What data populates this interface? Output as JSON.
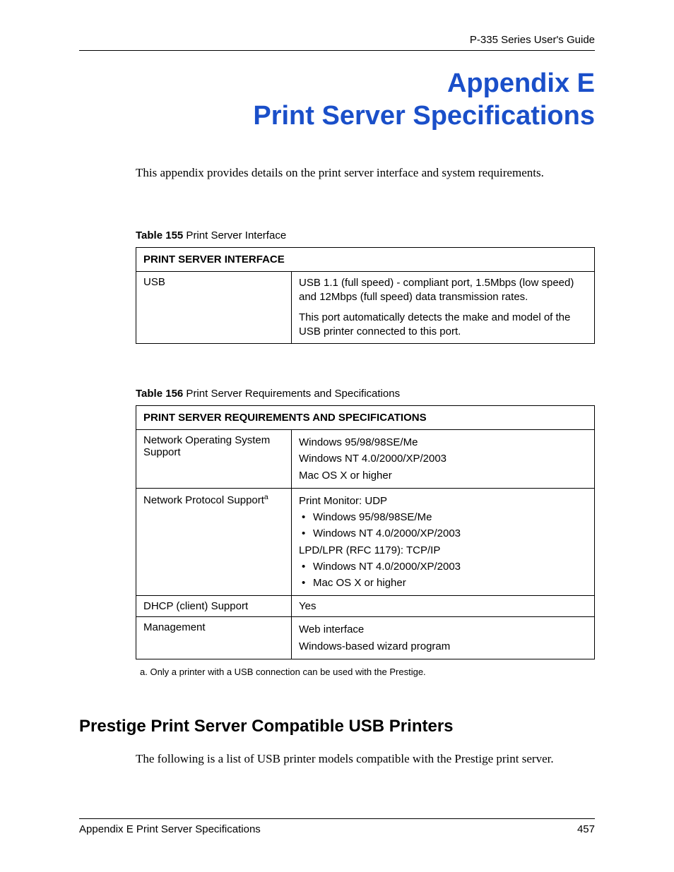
{
  "header": {
    "guide": "P-335 Series User's Guide"
  },
  "title": {
    "line1": "Appendix E",
    "line2": "Print Server Specifications"
  },
  "intro": "This appendix provides details on the print server interface and system requirements.",
  "table155": {
    "caption_bold": "Table 155",
    "caption_rest": "   Print Server Interface",
    "header": "PRINT SERVER INTERFACE",
    "row_label": "USB",
    "row_p1": "USB 1.1 (full speed) - compliant port, 1.5Mbps (low speed) and 12Mbps (full speed) data transmission rates.",
    "row_p2": "This port automatically detects the make and model of the USB printer connected to this port."
  },
  "table156": {
    "caption_bold": "Table 156",
    "caption_rest": "   Print Server Requirements and Specifications",
    "header": "PRINT SERVER REQUIREMENTS AND SPECIFICATIONS",
    "r1_label": "Network Operating System Support",
    "r1_v1": "Windows 95/98/98SE/Me",
    "r1_v2": "Windows NT 4.0/2000/XP/2003",
    "r1_v3": "Mac OS X or higher",
    "r2_label_base": "Network Protocol Support",
    "r2_sup": "a",
    "r2_intro1": "Print Monitor: UDP",
    "r2_b1": "Windows 95/98/98SE/Me",
    "r2_b2": "Windows NT 4.0/2000/XP/2003",
    "r2_intro2": "LPD/LPR (RFC 1179): TCP/IP",
    "r2_b3": "Windows NT 4.0/2000/XP/2003",
    "r2_b4": "Mac OS X or higher",
    "r3_label": "DHCP (client) Support",
    "r3_val": "Yes",
    "r4_label": "Management",
    "r4_v1": "Web interface",
    "r4_v2": "Windows-based wizard program"
  },
  "footnote": "a.  Only a printer with a USB connection can be used with the Prestige.",
  "section": {
    "heading": "Prestige Print Server Compatible USB Printers",
    "body": "The following is a list of USB printer models compatible with the Prestige print server."
  },
  "footer": {
    "left": "Appendix E Print Server Specifications",
    "right": "457"
  }
}
